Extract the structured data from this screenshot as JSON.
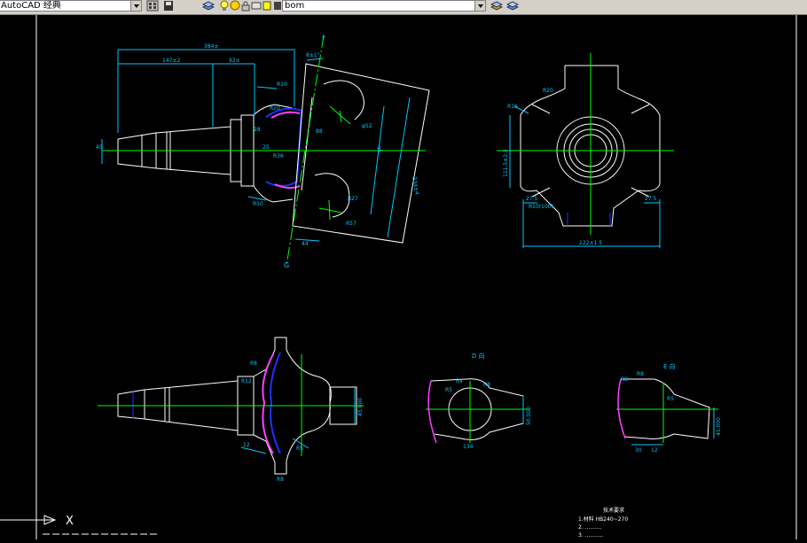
{
  "window": {
    "workspace_combo": "AutoCAD 经典",
    "layer_combo": "bom"
  },
  "colors": {
    "background": "#000000",
    "outline": "#ffffff",
    "dimension": "#00c8ff",
    "centerline": "#00ff00",
    "hidden": "#0000ff",
    "hatch": "#ff40ff",
    "layer_swatch": "#ffff00"
  },
  "drawing": {
    "main_view": {
      "label_F": "F",
      "label_G": "G",
      "dim_top_overall": "384±",
      "dim_top_left": "147±2",
      "dim_top_mid": "92±",
      "dim_top_angle": "8±1°",
      "dim_r10": "R10",
      "dim_r20": "R20",
      "dim_r36": "R36",
      "dim_r50": "R50",
      "dim_r27": "R27",
      "dim_r57": "R57",
      "dim_phi": "φ52",
      "dim_left": "45",
      "dim_bottom": "44",
      "dim_right_diag": "334±4",
      "dim_height": "96",
      "dim_a": "25",
      "dim_b": "28",
      "dim_c": "88"
    },
    "top_right_view": {
      "dim_r20": "R20",
      "dim_r16": "R16",
      "dim_height": "111.5±2.5",
      "dim_left_small": "27.5",
      "dim_right_small": "27.5",
      "dim_bottom": "222±1.5",
      "dim_r": "R10(100)"
    },
    "bottom_left_view": {
      "dim_r8": "R8",
      "dim_r12": "R12",
      "dim_r5": "R5",
      "dim_bottom_r": "R8",
      "dim_right": "45.000",
      "dim_left": "12"
    },
    "detail_d": {
      "title": "D 向",
      "dim_r4": "R4",
      "dim_r8": "R8",
      "dim_r5": "R5",
      "dim_right": "50.000",
      "dim_bottom": "134"
    },
    "detail_e": {
      "title": "E 向",
      "dim_r8": "R8",
      "dim_r5": "R5",
      "dim_top": "R8",
      "dim_right": "45.000",
      "dim_bottom_a": "30",
      "dim_bottom_b": "12"
    },
    "notes": {
      "heading": "技术要求",
      "line1": "1.材料  HB240~270",
      "line2": "2. ..........",
      "line3": "3. ..........."
    },
    "ucs_label": "X"
  }
}
